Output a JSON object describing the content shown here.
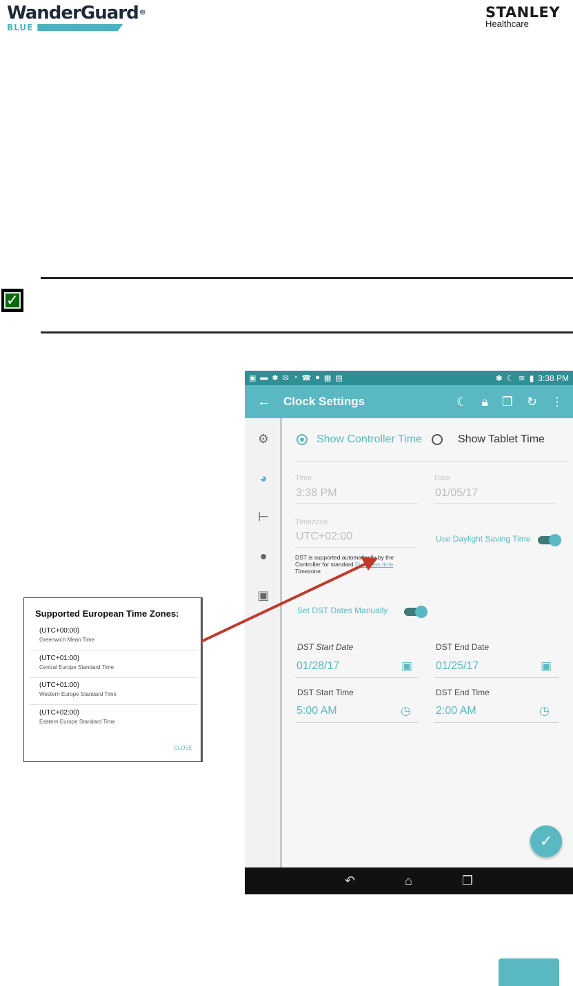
{
  "doc": {
    "brand_left": "WanderGuard",
    "brand_left_reg": "®",
    "brand_left_sub": "BLUE",
    "brand_right": "STANLEY",
    "brand_right_sub": "Healthcare",
    "brand_color": "#4ab3bf"
  },
  "status_bar": {
    "left_icons": [
      "notification-icon",
      "notification-icon",
      "bluetooth-icon",
      "mail-icon",
      "notification-icon",
      "phone-icon",
      "notification-icon",
      "photo-icon",
      "notification-icon"
    ],
    "time": "3:38 PM"
  },
  "app_bar": {
    "title": "Clock Settings",
    "back_icon": "back-arrow-icon",
    "action_icons": [
      "night-mode-icon",
      "lock-icon",
      "copy-icon",
      "refresh-icon",
      "more-vert-icon"
    ],
    "color": "#5ab8c3"
  },
  "side_nav": {
    "items": [
      "settings-icon",
      "clock-icon",
      "tree-icon",
      "person-icon",
      "calendar-icon"
    ],
    "active": "clock-icon"
  },
  "clock": {
    "show_controller_label": "Show Controller Time",
    "show_tablet_label": "Show Tablet Time",
    "time_label": "Time",
    "time_value": "3:38 PM",
    "date_label": "Date",
    "date_value": "01/05/17",
    "timezone_label": "Timezone",
    "timezone_value": "UTC+02:00",
    "dst_auto_label": "Use Daylight Saving Time",
    "dst_note_pre": "DST is supported automatically by the Controller for standard ",
    "dst_note_link": "European time",
    "dst_note_post": " Timezone",
    "dst_manual_label": "Set DST Dates Manually",
    "dst_start_date_label": "DST Start Date",
    "dst_start_date_value": "01/28/17",
    "dst_end_date_label": "DST End Date",
    "dst_end_date_value": "01/25/17",
    "dst_start_time_label": "DST Start Time",
    "dst_start_time_value": "5:00 AM",
    "dst_end_time_label": "DST End Time",
    "dst_end_time_value": "2:00 AM"
  },
  "dialog": {
    "title": "Supported European Time Zones:",
    "zones": [
      {
        "offset": "(UTC+00:00)",
        "name": "Greenwich Mean Time"
      },
      {
        "offset": "(UTC+01:00)",
        "name": "Central Europe Standard Time"
      },
      {
        "offset": "(UTC+01:00)",
        "name": "Western Europe Standard Time"
      },
      {
        "offset": "(UTC+02:00)",
        "name": "Eastern Europe Standard Time"
      }
    ],
    "close_label": "CLOSE"
  },
  "annotation": {
    "arrow_color": "#c0392b"
  }
}
